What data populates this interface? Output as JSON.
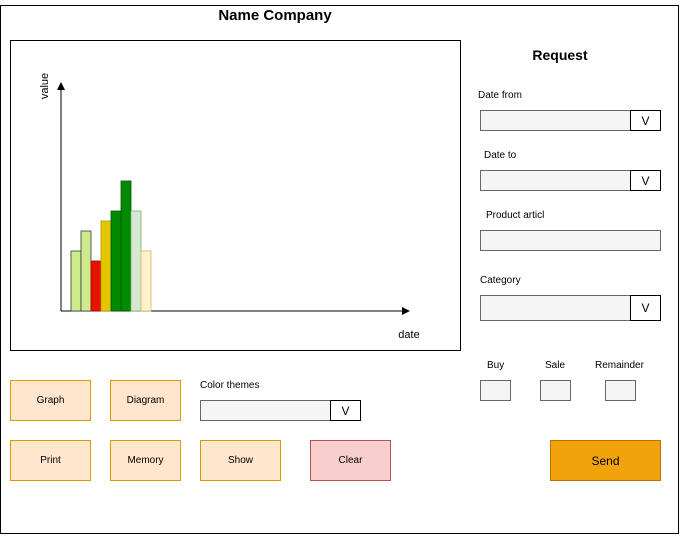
{
  "title": "Name Company",
  "chart_data": {
    "type": "bar",
    "xlabel": "date",
    "ylabel": "value",
    "categories": [
      "",
      "",
      "",
      "",
      "",
      "",
      "",
      ""
    ],
    "values": [
      3,
      4,
      2.5,
      4.5,
      5,
      6.5,
      5,
      3
    ],
    "colors": [
      "#cdeb8b",
      "#cdeb8b",
      "#e51400",
      "#e3c800",
      "#008a00",
      "#008a00",
      "#d5e8d4",
      "#fff2cc"
    ],
    "strokes": [
      "#36393d",
      "#36393d",
      "#b20000",
      "#b09500",
      "#005700",
      "#005700",
      "#82b366",
      "#d6b656"
    ]
  },
  "request": {
    "title": "Request",
    "date_from_label": "Date from",
    "date_from_value": "",
    "date_to_label": "Date to",
    "date_to_value": "",
    "product_label": "Product articl",
    "product_value": "",
    "category_label": "Category",
    "category_value": "",
    "dropdown_glyph": "V",
    "buy_label": "Buy",
    "sale_label": "Sale",
    "remainder_label": "Remainder",
    "send_label": "Send"
  },
  "controls": {
    "graph_label": "Graph",
    "diagram_label": "Diagram",
    "color_themes_label": "Color themes",
    "color_themes_value": "",
    "print_label": "Print",
    "memory_label": "Memory",
    "show_label": "Show",
    "clear_label": "Clear"
  }
}
